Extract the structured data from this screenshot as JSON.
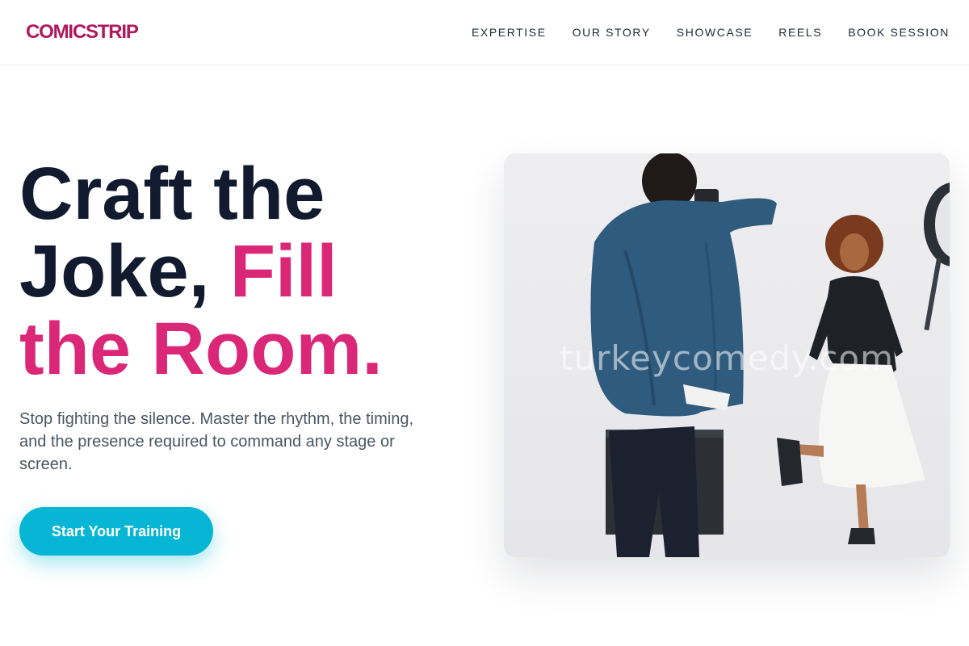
{
  "header": {
    "logo": "COMICSTRIP",
    "nav": [
      {
        "label": "EXPERTISE"
      },
      {
        "label": "OUR STORY"
      },
      {
        "label": "SHOWCASE"
      },
      {
        "label": "REELS"
      },
      {
        "label": "BOOK SESSION"
      }
    ]
  },
  "hero": {
    "headline_line1": "Craft the",
    "headline_line2_part1": "Joke, ",
    "headline_line2_part2": "Fill",
    "headline_line3": "the Room.",
    "subtext": "Stop fighting the silence. Master the rhythm, the timing, and the presence required to command any stage or screen.",
    "cta_label": "Start Your Training",
    "image_watermark": "turkeycomedy.com"
  },
  "colors": {
    "brand": "#b0185f",
    "accent": "#db2777",
    "cta": "#06b6d4",
    "headline": "#111a2e"
  }
}
